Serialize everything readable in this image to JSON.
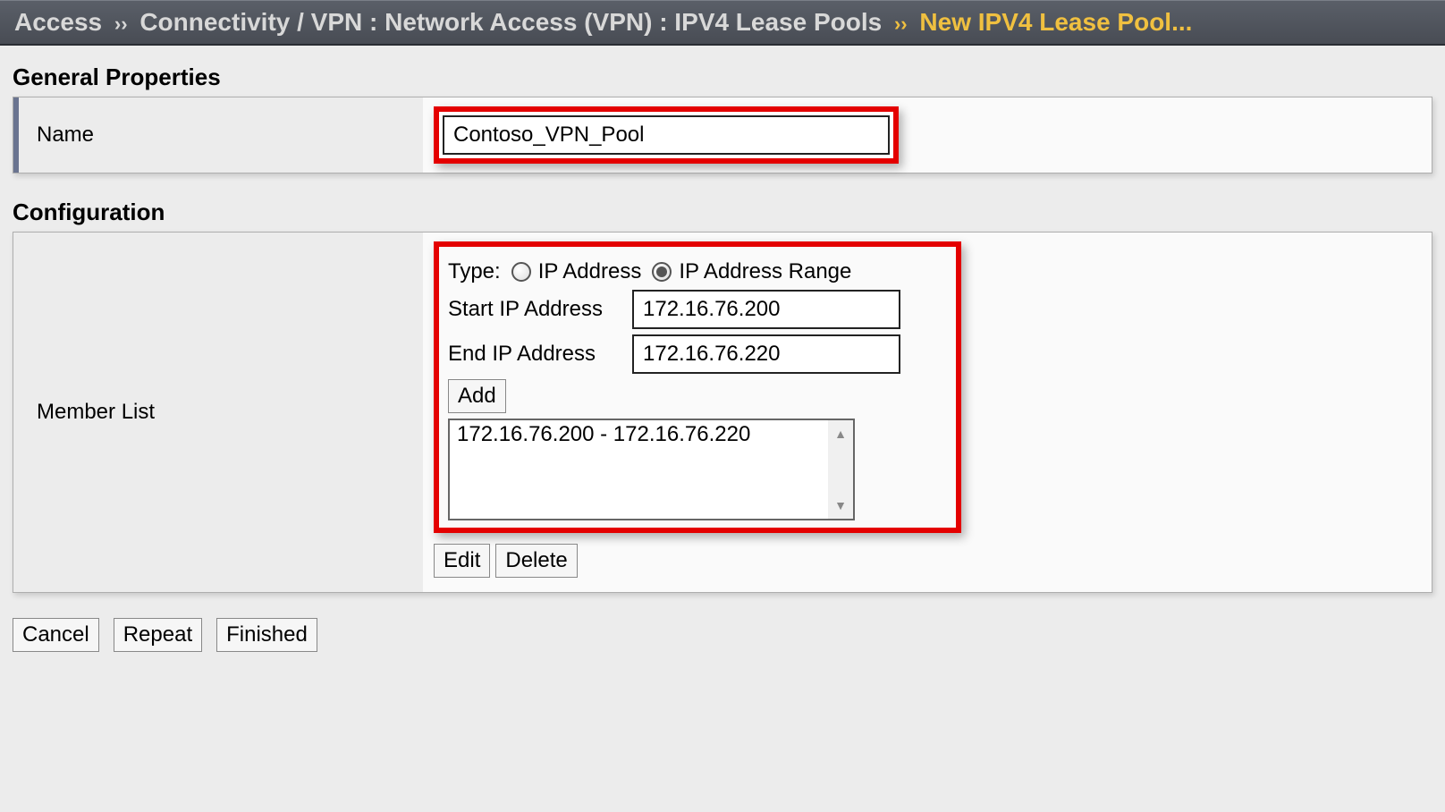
{
  "breadcrumb": {
    "seg1": "Access",
    "seg2": "Connectivity / VPN : Network Access (VPN) : IPV4 Lease Pools",
    "current": "New IPV4 Lease Pool...",
    "sep": "››"
  },
  "sections": {
    "general": "General Properties",
    "configuration": "Configuration"
  },
  "general": {
    "name_label": "Name",
    "name_value": "Contoso_VPN_Pool"
  },
  "config": {
    "member_list_label": "Member List",
    "type_label": "Type:",
    "type_options": {
      "ip_address": "IP Address",
      "ip_address_range": "IP Address Range",
      "selected": "ip_address_range"
    },
    "start_ip_label": "Start IP Address",
    "start_ip_value": "172.16.76.200",
    "end_ip_label": "End IP Address",
    "end_ip_value": "172.16.76.220",
    "add_button": "Add",
    "member_list_items": [
      "172.16.76.200 - 172.16.76.220"
    ],
    "edit_button": "Edit",
    "delete_button": "Delete"
  },
  "footer": {
    "cancel": "Cancel",
    "repeat": "Repeat",
    "finished": "Finished"
  }
}
